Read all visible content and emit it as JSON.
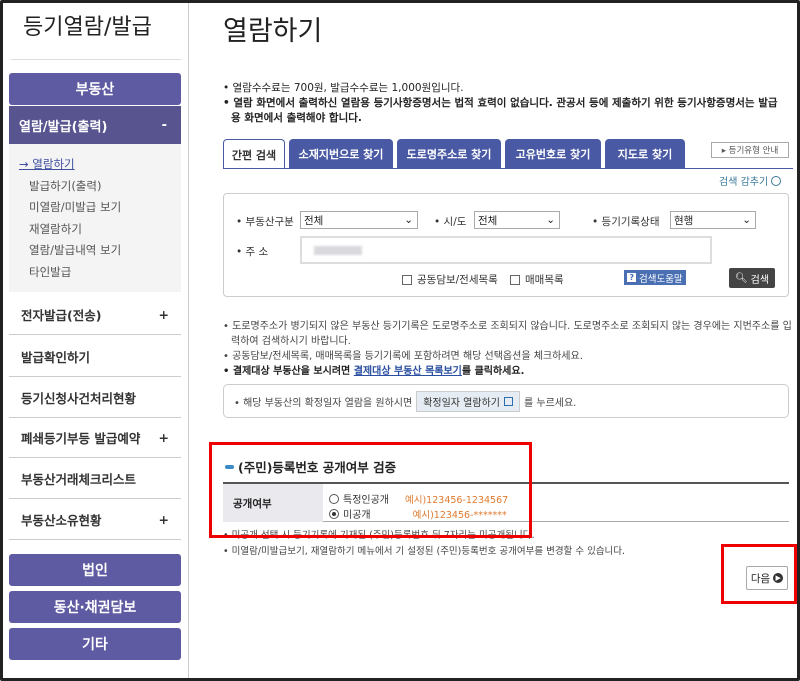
{
  "sidebar": {
    "title": "등기열람/발급",
    "real_estate": "부동산",
    "active_section": "열람/발급(출력)",
    "active_toggle": "-",
    "sub_items": [
      "→ 열람하기",
      "발급하기(출력)",
      "미열람/미발급 보기",
      "재열람하기",
      "열람/발급내역 보기",
      "타인발급"
    ],
    "items": [
      {
        "label": "전자발급(전송)",
        "toggle": "+"
      },
      {
        "label": "발급확인하기",
        "toggle": ""
      },
      {
        "label": "등기신청사건처리현황",
        "toggle": ""
      },
      {
        "label": "폐쇄등기부등 발급예약",
        "toggle": "+"
      },
      {
        "label": "부동산거래체크리스트",
        "toggle": ""
      },
      {
        "label": "부동산소유현황",
        "toggle": "+"
      }
    ],
    "bottom_buttons": [
      "법인",
      "동산·채권담보",
      "기타"
    ]
  },
  "main": {
    "title": "열람하기",
    "top_notes": [
      "• 열람수수료는 700원, 발급수수료는 1,000원입니다.",
      "• 열람 화면에서 출력하신 열람용 등기사항증명서는 법적 효력이 없습니다. 관공서 등에 제출하기 위한 등기사항증명서는 발급용 화면에서 출력해야 합니다."
    ],
    "tabs": [
      "간편 검색",
      "소재지번으로 찾기",
      "도로명주소로 찾기",
      "고유번호로 찾기",
      "지도로 찾기"
    ],
    "guide_button": "▸ 등기유형 안내",
    "search_hide": "검색 감추기",
    "form": {
      "type_label": "• 부동산구분",
      "type_value": "전체",
      "city_label": "• 시/도",
      "city_value": "전체",
      "status_label": "• 등기기록상태",
      "status_value": "현행",
      "addr_label": "• 주 소",
      "check1": "공동담보/전세목록",
      "check2": "매매목록",
      "help_button": "검색도움말",
      "search_button": "검색"
    },
    "mid_notes": {
      "n1": "• 도로명주소가 병기되지 않은 부동산 등기기록은 도로명주소로 조회되지 않습니다. 도로명주소로 조회되지 않는 경우에는 지번주소를 입력하여 검색하시기 바랍니다.",
      "n2": "• 공동담보/전세목록, 매매목록을 등기기록에 포함하려면 해당 선택옵션을 체크하세요.",
      "n3_bold": "• 결제대상 부동산을 보시려면 ",
      "n3_link": "결제대상 부동산 목록보기",
      "n3_end": "를 클릭하세요."
    },
    "info_box": {
      "pre": "• 해당 부동산의 확정일자 열람을 원하시면",
      "button": "확정일자 열람하기",
      "post": "를 누르세요."
    },
    "rrn": {
      "title": "(주민)등록번호 공개여부 검증",
      "header": "공개여부",
      "opt1": "특정인공개",
      "opt1_ex": "예시)123456-1234567",
      "opt2": "미공개",
      "opt2_ex": "예시)123456-*******"
    },
    "bottom_notes": [
      "• 미공개 선택 시 등기기록에 기재된 (주민)등록번호 뒤 7자리는 미공개됩니다.",
      "• 미열람/미발급보기, 재열람하기 메뉴에서 기 설정된 (주민)등록번호 공개여부를 변경할 수 있습니다."
    ],
    "next_button": "다음"
  }
}
